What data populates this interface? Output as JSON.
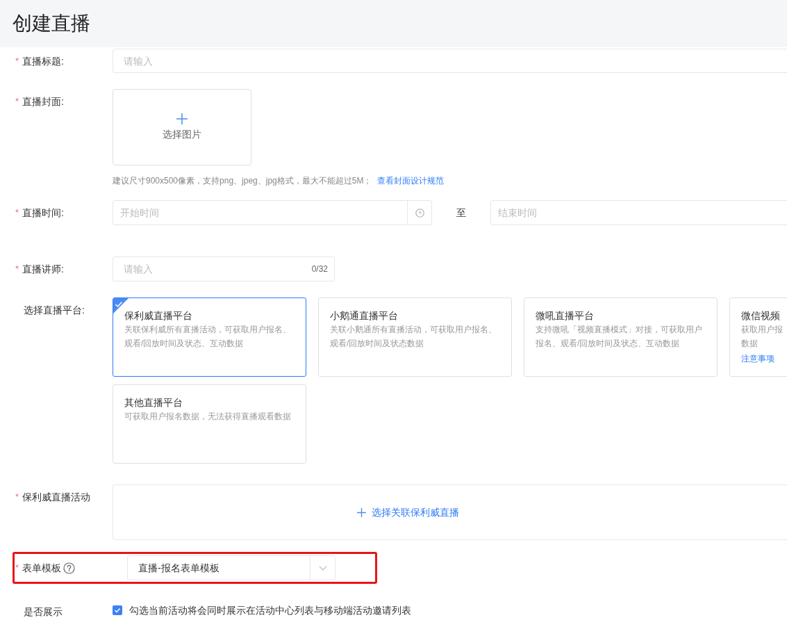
{
  "page_title": "创建直播",
  "fields": [
    {
      "kind": "text",
      "label": "直播标题:",
      "required": "*",
      "placeholder": "请输入"
    },
    {
      "kind": "upload",
      "label": "直播封面:",
      "required": "*",
      "button": "选择图片",
      "hint": "建议尺寸900x500像素，支持png、jpeg、jpg格式，最大不能超过5M；",
      "link": "查看封面设计规范"
    },
    {
      "kind": "range",
      "label": "直播时间:",
      "required": "*",
      "start_placeholder": "开始时间",
      "separator": "至",
      "end_placeholder": "结束时间"
    },
    {
      "kind": "counter",
      "label": "直播讲师:",
      "required": "*",
      "placeholder": "请输入",
      "count": "0/32"
    },
    {
      "kind": "platforms",
      "label": "选择直播平台:",
      "options": [
        {
          "title": "保利威直播平台",
          "description": "关联保利威所有直播活动，可获取用户报名、观看/回放时间及状态、互动数据",
          "selected": true
        },
        {
          "title": "小鹅通直播平台",
          "description": "关联小鹅通所有直播活动，可获取用户报名、观看/回放时间及状态数据",
          "selected": false
        },
        {
          "title": "微吼直播平台",
          "description": "支持微吼「视频直播模式」对接，可获取用户报名、观看/回放时间及状态、互动数据",
          "selected": false
        },
        {
          "title": "微信视频",
          "description": [
            "获取用户报",
            "数据"
          ],
          "link": "注意事项",
          "selected": false
        },
        {
          "title": "其他直播平台",
          "description": "可获取用户报名数据，无法获得直播观看数据",
          "selected": false
        }
      ]
    },
    {
      "kind": "picker",
      "label": "保利威直播活动",
      "required": "*",
      "action": "选择关联保利威直播"
    },
    {
      "kind": "select",
      "label": "表单模板",
      "required": "*",
      "help": true,
      "highlighted": true,
      "value": "直播-报名表单模板"
    },
    {
      "kind": "checkbox",
      "label": "是否展示",
      "checked": true,
      "text": "勾选当前活动将会同时展示在活动中心列表与移动端活动邀请列表"
    }
  ]
}
